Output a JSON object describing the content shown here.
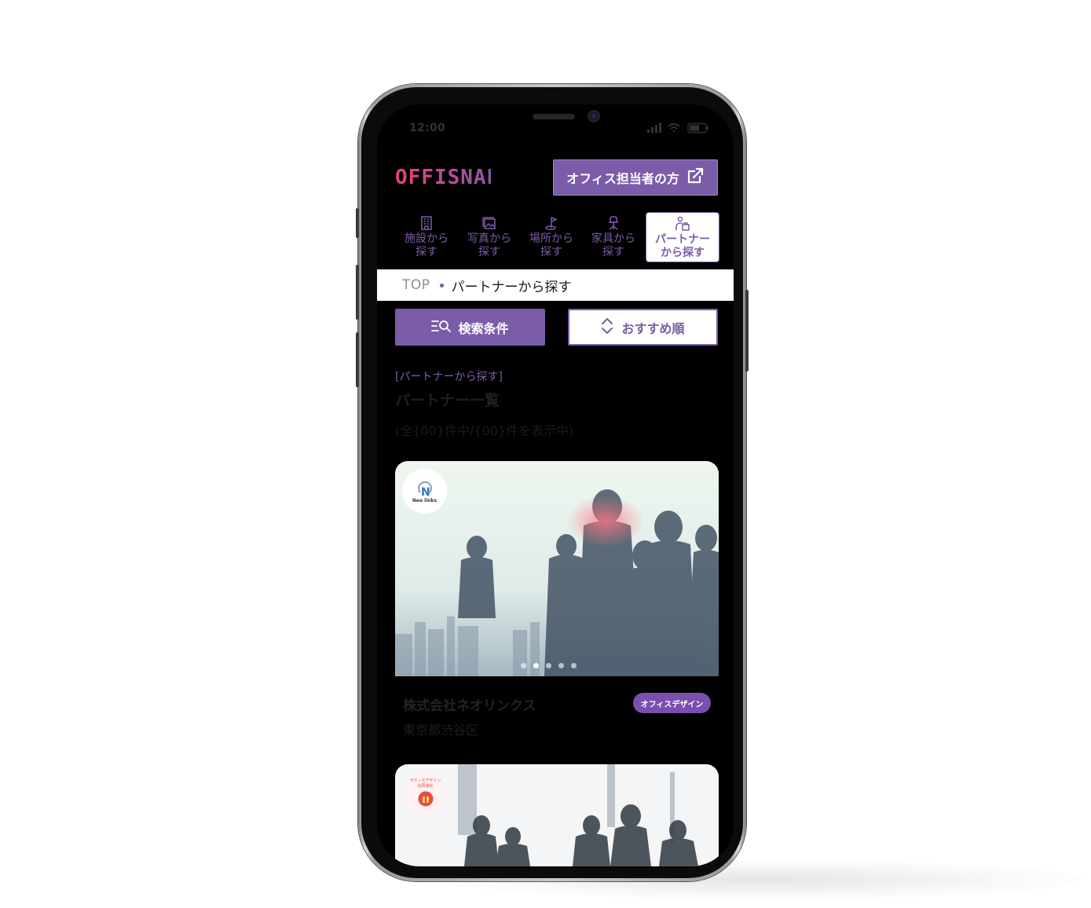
{
  "status_bar": {
    "time": "12:00",
    "icons": [
      "signal-icon",
      "wifi-icon",
      "battery-icon"
    ]
  },
  "header": {
    "logo_text": "OFFISNAP",
    "office_button_label": "オフィス担当者の方",
    "office_button_icon": "external-link-icon"
  },
  "nav": {
    "items": [
      {
        "label": "施設から\n探す",
        "icon": "building-icon",
        "active": false
      },
      {
        "label": "写真から\n探す",
        "icon": "photo-icon",
        "active": false
      },
      {
        "label": "場所から\n探す",
        "icon": "location-flag-icon",
        "active": false
      },
      {
        "label": "家具から\n探す",
        "icon": "chair-icon",
        "active": false
      },
      {
        "label": "パートナー\nから探す",
        "icon": "partner-icon",
        "active": true
      }
    ]
  },
  "breadcrumb": {
    "top": "TOP",
    "current": "パートナーから探す"
  },
  "actions": {
    "search_label": "検索条件",
    "sort_label": "おすすめ順"
  },
  "section": {
    "subtitle": "[パートナーから探す]",
    "title": "パートナー一覧",
    "count": "(全{00}件中/{00}件を表示中)"
  },
  "cards": [
    {
      "logo_text": "Neo links",
      "name": "株式会社ネオリンクス",
      "location": "東京都渋谷区",
      "tag": "オフィスデザイン",
      "slide_count": 5,
      "active_slide": 1
    },
    {
      "logo_text": "ラクノスデザイン合同会社"
    }
  ],
  "colors": {
    "accent": "#7b5ca8",
    "tag": "#7b4fae",
    "screen_bg": "#000000"
  }
}
